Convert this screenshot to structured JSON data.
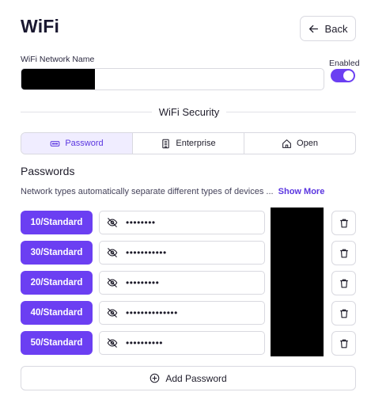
{
  "header": {
    "title": "WiFi",
    "back_label": "Back"
  },
  "network": {
    "label": "WiFi Network Name",
    "value": "",
    "enabled_label": "Enabled",
    "enabled": true
  },
  "security": {
    "section_title": "WiFi Security",
    "options": [
      {
        "label": "Password",
        "icon": "password-icon",
        "active": true
      },
      {
        "label": "Enterprise",
        "icon": "enterprise-icon",
        "active": false
      },
      {
        "label": "Open",
        "icon": "home-icon",
        "active": false
      }
    ]
  },
  "passwords": {
    "heading": "Passwords",
    "description": "Network types automatically separate different types of devices ...",
    "show_more": "Show More",
    "rows": [
      {
        "type": "10/Standard",
        "masked": "••••••••"
      },
      {
        "type": "30/Standard",
        "masked": "•••••••••••"
      },
      {
        "type": "20/Standard",
        "masked": "•••••••••"
      },
      {
        "type": "40/Standard",
        "masked": "••••••••••••••"
      },
      {
        "type": "50/Standard",
        "masked": "••••••••••"
      }
    ],
    "add_label": "Add Password"
  },
  "colors": {
    "accent": "#6b3ff2",
    "accent_soft": "#f0edff",
    "border": "#d9d9e0"
  }
}
